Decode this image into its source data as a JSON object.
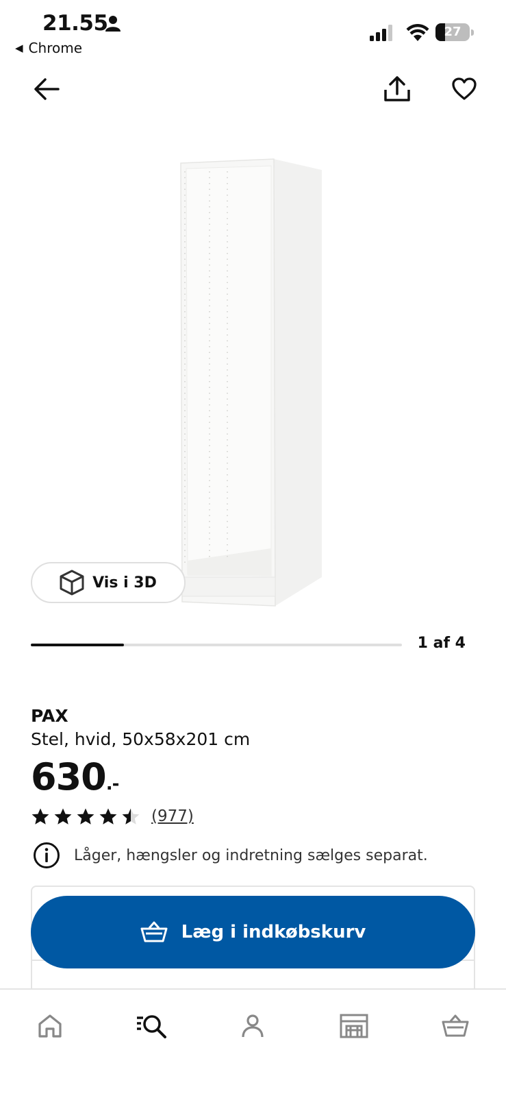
{
  "status_bar": {
    "time": "21.55",
    "back_app": "Chrome",
    "battery": "27",
    "battery_level": 0.27
  },
  "header": {
    "icons": [
      "arrow-left-icon",
      "share-icon",
      "heart-icon"
    ]
  },
  "gallery": {
    "view3d_label": "Vis i 3D",
    "counter": "1 af 4",
    "current_index": 1,
    "total_images": 4
  },
  "product": {
    "name": "PAX",
    "description": "Stel, hvid, 50x58x201 cm",
    "price": "630",
    "price_suffix": ".-",
    "rating": 4.5,
    "rating_max": 5,
    "review_count": "(977)",
    "notice": "Låger, hængsler og indretning sælges separat."
  },
  "cta": {
    "label": "Læg i indkøbskurv"
  },
  "tabbar": {
    "items": [
      "home-icon",
      "search-icon",
      "profile-icon",
      "store-icon",
      "basket-icon"
    ],
    "active": "search-icon"
  },
  "colors": {
    "accent": "#0058a3",
    "text": "#111111",
    "muted": "#484848"
  }
}
